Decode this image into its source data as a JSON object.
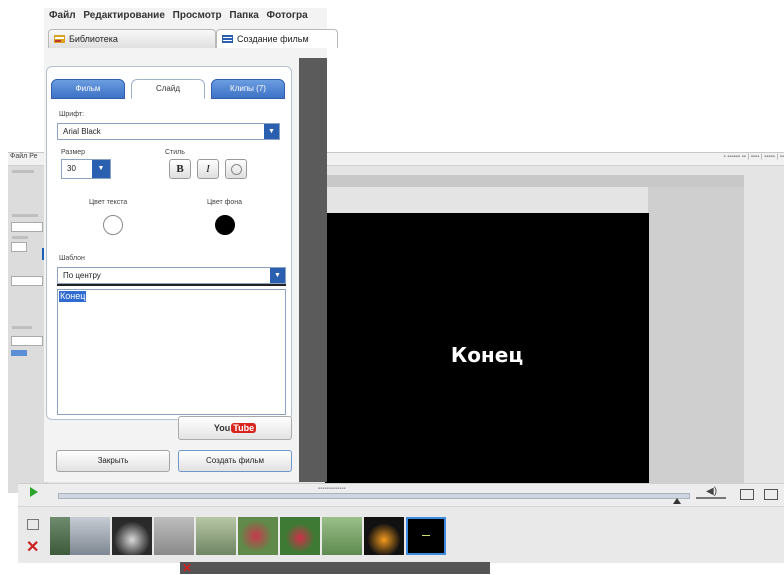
{
  "window": {
    "menu": [
      "Файл",
      "Редактирование",
      "Просмотр",
      "Папка",
      "Фотогра"
    ],
    "tabs": [
      {
        "label": "Библиотека",
        "icon": "library-icon"
      },
      {
        "label": "Создание фильм",
        "icon": "movie-maker-icon"
      }
    ]
  },
  "panel": {
    "subtabs": [
      "Фильм",
      "Слайд",
      "Клипы (7)"
    ],
    "active_subtab": "Слайд",
    "font_label": "Шрифт:",
    "font_value": "Arial Black",
    "size_label": "Размер",
    "size_value": "30",
    "styles_label": "Стиль",
    "bold": "B",
    "italic": "I",
    "text_color_label": "Цвет текста",
    "bg_color_label": "Цвет фона",
    "text_color": "#ffffff",
    "bg_color": "#000000",
    "template_label": "Шаблон",
    "template_value": "По центру",
    "text_content": "Конец",
    "youtube_you": "You",
    "youtube_tube": "Tube",
    "close_button": "Закрыть",
    "create_button": "Создать фильм"
  },
  "preview": {
    "text": "Конец"
  },
  "colors": {
    "accent": "#2b5fb0",
    "tab_blue": "#4a80d0",
    "delete_red": "#cc1f1f",
    "play_green": "#2ea62e"
  },
  "timeline": {
    "delete_icon": "✕",
    "thumbnails": 10,
    "selected_index": 9
  }
}
